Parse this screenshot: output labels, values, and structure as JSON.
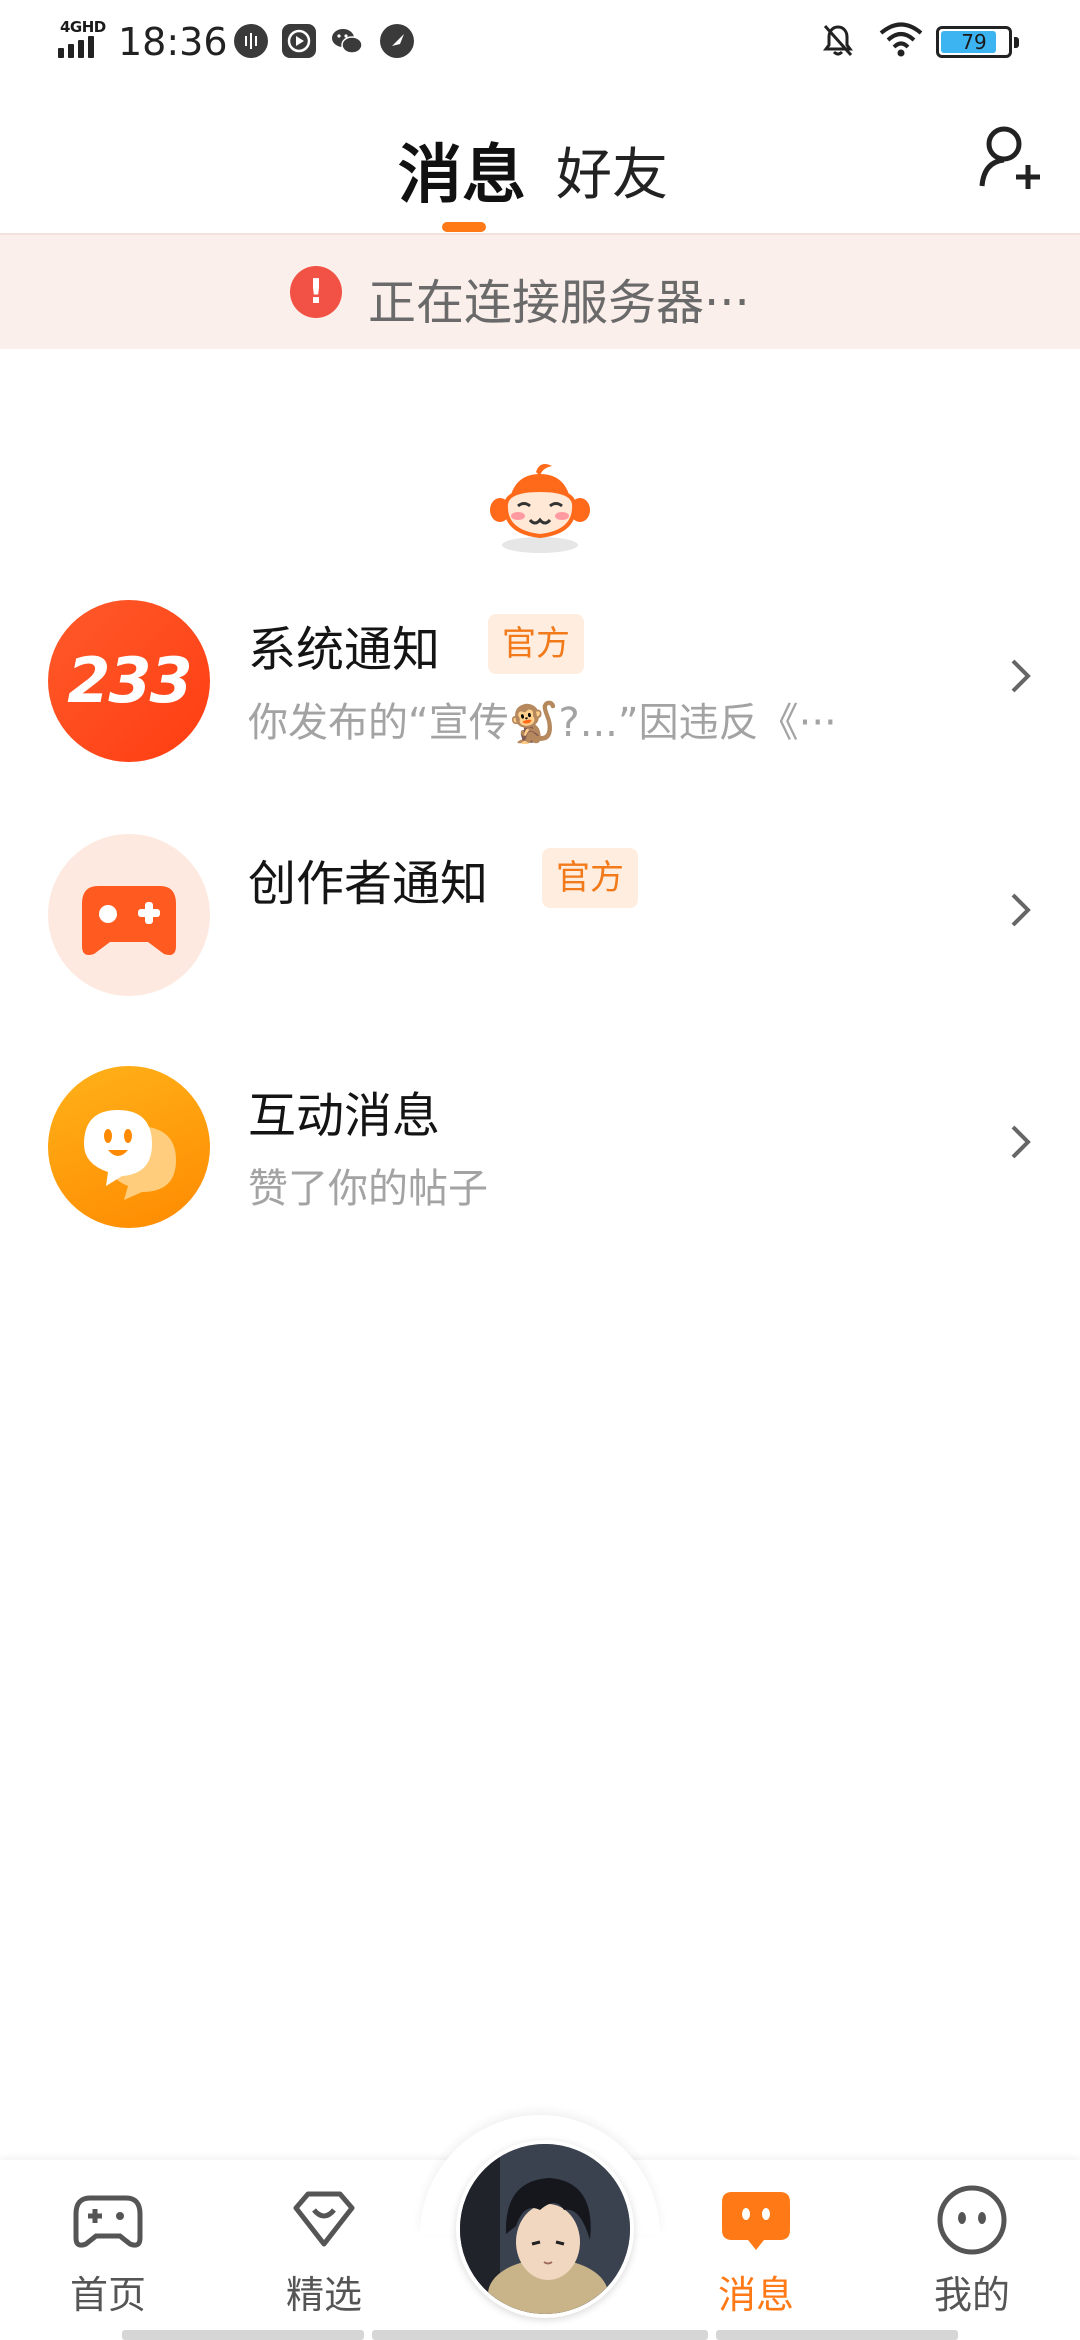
{
  "status_bar": {
    "network": "4GHD",
    "time": "18:36",
    "battery": "79"
  },
  "header": {
    "tabs": [
      {
        "label": "消息",
        "active": true
      },
      {
        "label": "好友",
        "active": false
      }
    ],
    "add_friend_icon": "person-plus-icon"
  },
  "banner": {
    "icon": "!",
    "text": "正在连接服务器···"
  },
  "messages": [
    {
      "title": "系统通知",
      "badge": "官方",
      "preview": "你发布的“宣传🐒?...”因违反《···",
      "avatar_text": "233"
    },
    {
      "title": "创作者通知",
      "badge": "官方",
      "preview": ""
    },
    {
      "title": "互动消息",
      "badge": "",
      "preview": "赞了你的帖子"
    }
  ],
  "bottom_nav": {
    "items": [
      {
        "label": "首页",
        "icon": "gamepad-icon",
        "active": false
      },
      {
        "label": "精选",
        "icon": "heart-diamond-icon",
        "active": false
      },
      {
        "label": "消息",
        "icon": "chat-bubble-icon",
        "active": true
      },
      {
        "label": "我的",
        "icon": "smiley-face-icon",
        "active": false
      }
    ]
  },
  "colors": {
    "accent": "#ff7a17",
    "banner_bg": "#fbefeb",
    "error": "#f15245",
    "badge_bg": "#ffeee0"
  }
}
